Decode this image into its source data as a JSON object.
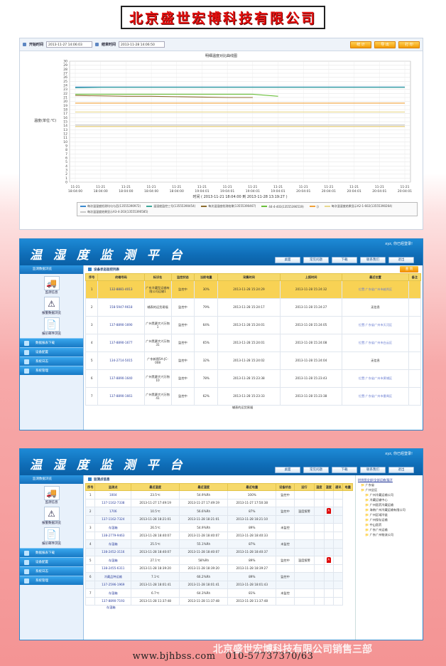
{
  "banner": {
    "title": "北京盛世宏博科技有限公司"
  },
  "panel1": {
    "start_label": "开始时间",
    "start_value": "2013-11-27 14:06:03",
    "end_label": "结束时间",
    "end_value": "2013-11-28 14:06:50",
    "btn_stat": "统 计",
    "btn_export": "导 出",
    "btn_print": "打 印",
    "chart_title": "明细温度对比曲线图",
    "time_label": "时间 ( 2013-11-21 18:04:00  到  2013-11-28 13:19:27 )"
  },
  "chart_data": {
    "type": "line",
    "title": "明细温度对比曲线图",
    "ylabel": "温度(单位:℃)",
    "xlabel": "时间 ( 2013-11-21 18:04:00  到  2013-11-28 13:19:27 )",
    "ylim": [
      0,
      30
    ],
    "yticks": [
      0,
      1,
      2,
      3,
      4,
      5,
      6,
      7,
      8,
      9,
      10,
      11,
      12,
      13,
      14,
      15,
      16,
      17,
      18,
      19,
      20,
      21,
      22,
      23,
      24,
      25,
      26,
      27,
      28,
      29,
      30
    ],
    "x_ticks": [
      "11-21 18:04:00",
      "11-21 18:04:00",
      "11-21 18:04:00",
      "11-21 18:04:00",
      "11-21 18:04:00",
      "11-21 19:04:01",
      "11-21 19:04:01",
      "11-21 19:04:01",
      "11-21 19:04:01",
      "11-21 20:04:01",
      "11-21 20:04:01",
      "11-21 20:04:01",
      "11-21 20:04:01",
      "11-21 20:04:01"
    ],
    "grid": true,
    "series": [
      {
        "color": "#3c8ad0",
        "values": [
          23.6,
          23.6,
          23.6,
          23.6,
          23.6,
          23.6,
          23.6,
          23.6,
          23.6,
          23.6,
          23.6,
          23.6,
          23.6,
          23.6
        ]
      },
      {
        "color": "#3fa79a",
        "values": [
          23.4,
          23.5,
          23.5,
          23.5,
          23.5,
          23.5,
          23.5,
          23.5,
          23.5,
          23.5,
          23.5,
          23.5,
          23.5,
          23.5
        ]
      },
      {
        "color": "#8d6d2f",
        "values": [
          21.5,
          21.4,
          21.3,
          21.3,
          21.2,
          21.1,
          21.0,
          21.0,
          null,
          null,
          null,
          null,
          null,
          null
        ]
      },
      {
        "color": "#6bbf3b",
        "values": [
          21.8,
          21.8,
          21.8,
          21.8,
          21.8,
          21.8,
          21.8,
          21.8,
          21.3,
          null,
          null,
          null,
          null,
          null
        ]
      },
      {
        "color": "#f0a23a",
        "values": [
          19.6,
          19.6,
          19.6,
          19.6,
          19.6,
          19.6,
          19.6,
          19.6,
          19.6,
          19.6,
          19.6,
          19.6,
          19.6,
          19.6
        ]
      },
      {
        "color": "#e8d88f",
        "values": [
          17.4,
          17.4,
          17.4,
          17.4,
          17.4,
          17.4,
          17.4,
          17.4,
          17.4,
          17.4,
          17.4,
          17.4,
          17.4,
          17.4
        ]
      },
      {
        "color": "#c9c9c9",
        "values": [
          14.2,
          14.2,
          14.2,
          14.2,
          14.2,
          14.2,
          14.2,
          14.2,
          14.2,
          14.2,
          14.2,
          14.2,
          14.2,
          14.2
        ]
      },
      {
        "color": "#e4c96b",
        "values": [
          13.8,
          13.8,
          13.8,
          13.8,
          13.8,
          13.8,
          13.8,
          13.8,
          13.8,
          13.8,
          13.8,
          13.8,
          13.8,
          13.8
        ]
      }
    ]
  },
  "legend": [
    "每次温湿度检测均匀与否(13555390972)",
    "温湿度监控三号(13555390454)",
    "每次温湿度检测结果(13555390467)",
    "44-4-403(13555390519)",
    "()",
    "每次温湿度结果显示A2-1-602(13555390264)",
    "每次温湿度结果显示A3-4-203(13555390585)"
  ],
  "app": {
    "title": "温 湿 度 监 测 平 台",
    "welcome": "xyz, 你已经登录!",
    "nav": [
      "桌面",
      "常见问题",
      "下载",
      "联系我们",
      "退出"
    ],
    "side_header": "监测数据浏览",
    "tiles": [
      "监测信息",
      "报警数据浏览",
      "报价邮件浏览"
    ],
    "menus": [
      "数据报表下载",
      "设备配置",
      "系统日志",
      "系统管理"
    ]
  },
  "app2": {
    "section": "设备状态监控列表",
    "query": "查 询",
    "headers": [
      "序号",
      "终端号码",
      "标识名",
      "监控状态",
      "当前电量",
      "采集时间",
      "上报时间",
      "最近位置",
      "备注"
    ],
    "rows": [
      [
        "1",
        "132-8881-4013",
        "广东冷藏型运输有限公司运输1",
        "监控中",
        "30%",
        "2013-11-28 15:24:29",
        "2013-11-28 15:24:32",
        "位置:广东省广州市越秀区",
        ""
      ],
      [
        "2",
        "158-5947-9618",
        "辅表的运货易福",
        "监控中",
        "79%",
        "2013-11-28 15:24:17",
        "2013-11-28 15:24:27",
        "无信息",
        ""
      ],
      [
        "3",
        "137-8890-1690",
        "广州黑豪大兴万物1",
        "监控中",
        "64%",
        "2013-11-28 15:24:01",
        "2013-11-28 15:24:05",
        "位置:广东省广州市天河区",
        ""
      ],
      [
        "4",
        "137-8890-1677",
        "广州黑豪大兴万物31",
        "监控中",
        "65%",
        "2013-11-28 15:24:01",
        "2013-11-28 15:24:08",
        "位置:广东省广州市白云区",
        ""
      ],
      [
        "5",
        "134-2714-5015",
        "广东新图5A-JC-008",
        "监控中",
        "32%",
        "2013-11-28 15:24:02",
        "2013-11-28 15:24:04",
        "无信息",
        ""
      ],
      [
        "6",
        "137-8890-1640",
        "广州黑豪大兴万物10",
        "监控中",
        "78%",
        "2013-11-28 15:23:38",
        "2013-11-28 15:23:43",
        "位置:广东省广州市黄埔区",
        ""
      ],
      [
        "7",
        "137-8890-1661",
        "广州黑豪大兴万物41",
        "监控中",
        "62%",
        "2013-11-28 15:23:33",
        "2013-11-28 15:23:38",
        "位置:广东省广州市番禺区",
        ""
      ]
    ],
    "trailing": "辅表的运货易福"
  },
  "app3": {
    "section": "监测点信息",
    "headers": [
      "序号",
      "监测点",
      "最近温度",
      "最近湿度",
      "最近电量",
      "设备状态",
      "运行",
      "温度",
      "湿度",
      "通讯",
      "电量"
    ],
    "rows": [
      [
        "1",
        "1004",
        "23.5℃",
        "54.9%Rh",
        "100%",
        "监控中",
        "",
        "",
        "",
        ""
      ],
      [
        "",
        "137-1162-7338",
        "2013-11-27 17:49:19",
        "2013-11-27 17:49:19",
        "2013-11-27 17:50:38",
        "",
        "",
        "",
        "",
        ""
      ],
      [
        "2",
        "1706",
        "10.5℃",
        "56.6%Rh",
        "87%",
        "监控中",
        "温度报警",
        "",
        "",
        ""
      ],
      [
        "",
        "137-1162-7324",
        "2013-11-28 18:21:01",
        "2013-11-28 18:21:01",
        "2013-11-28 18:21:10",
        "",
        "",
        "",
        "",
        ""
      ],
      [
        "3",
        "存温箱",
        "26.5℃",
        "54.9%Rh",
        "89%",
        "未监控",
        "",
        "",
        "",
        ""
      ],
      [
        "",
        "138-2779-9463",
        "2013-11-28 18:40:07",
        "2013-11-28 18:40:07",
        "2013-11-28 18:40:33",
        "",
        "",
        "",
        "",
        ""
      ],
      [
        "4",
        "存温箱",
        "25.5℃",
        "55.1%Rh",
        "87%",
        "未监控",
        "",
        "",
        "",
        ""
      ],
      [
        "",
        "138-2452-3116",
        "2013-11-28 18:40:07",
        "2013-11-28 18:40:07",
        "2013-11-28 18:40:37",
        "",
        "",
        "",
        "",
        ""
      ],
      [
        "5",
        "存温箱",
        "27.1℃",
        "58%Rh",
        "89%",
        "监控中",
        "温度报警",
        "",
        "",
        ""
      ],
      [
        "",
        "138-2455-6311",
        "2013-11-28 18:39:20",
        "2013-11-28 18:39:20",
        "2013-11-28 18:39:27",
        "",
        "",
        "",
        "",
        ""
      ],
      [
        "6",
        "冷藏品种运输",
        "7.1℃",
        "66.2%Rh",
        "89%",
        "监控中",
        "",
        "",
        "",
        ""
      ],
      [
        "",
        "137-2596-1969",
        "2013-11-28 18:01:41",
        "2013-11-28 18:01:41",
        "2013-11-28 18:01:43",
        "",
        "",
        "",
        "",
        ""
      ],
      [
        "7",
        "存温箱",
        "6.7℃",
        "64.3%Rh",
        "81%",
        "未监控",
        "",
        "",
        "",
        ""
      ],
      [
        "",
        "137-8890-7193",
        "2013-11-28 11:37:48",
        "2013-11-28 11:37:48",
        "2013-11-28 11:37:48",
        "",
        "",
        "",
        "",
        ""
      ]
    ],
    "alarm": "A",
    "tree": [
      "树状图全部/全部运输/展开",
      "广东省",
      "广州全区",
      "广州冷藏运输公司",
      "冷藏运输中心",
      "广州医药冷藏运输",
      "海南广州冷藏运输有限公司",
      "广州区域冷链",
      "广州保存运输",
      "中山医药",
      "广东广州运输",
      "广东广州物流公司"
    ],
    "trailing": "存温箱"
  },
  "footer": {
    "url": "www.bjhbss.com",
    "phone": "010-57737370/63",
    "company": "北京盛世宏博科技有限公司销售三部"
  }
}
